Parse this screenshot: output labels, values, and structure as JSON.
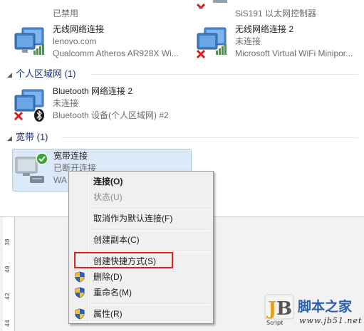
{
  "top_partial": {
    "left_sub": "已禁用",
    "right_sub": "SiS191 以太网控制器"
  },
  "wireless_connections": [
    {
      "name": "无线网络连接",
      "status": "lenovo.com",
      "device": "Qualcomm Atheros AR928X Wi..."
    },
    {
      "name": "无线网络连接 2",
      "status": "未连接",
      "device": "Microsoft Virtual WiFi Minipor..."
    }
  ],
  "groups": {
    "pan": "个人区域网 (1)",
    "broadband": "宽带 (1)"
  },
  "bluetooth_connection": {
    "name": "Bluetooth 网络连接 2",
    "status": "未连接",
    "device": "Bluetooth 设备(个人区域网) #2"
  },
  "broadband_connection": {
    "name": "宽带连接",
    "status": "已断开连接",
    "device": "WA"
  },
  "ruler_labels": [
    "38",
    "40",
    "42",
    "44"
  ],
  "context_menu": {
    "items": [
      {
        "label": "连接(O)",
        "bold": true,
        "disabled": false,
        "shield": false
      },
      {
        "label": "状态(U)",
        "bold": false,
        "disabled": true,
        "shield": false
      },
      {
        "label": "取消作为默认连接(F)",
        "bold": false,
        "disabled": false,
        "shield": false
      },
      {
        "label": "创建副本(C)",
        "bold": false,
        "disabled": false,
        "shield": false
      },
      {
        "label": "创建快捷方式(S)",
        "bold": false,
        "disabled": false,
        "shield": false
      },
      {
        "label": "删除(D)",
        "bold": false,
        "disabled": false,
        "shield": true
      },
      {
        "label": "重命名(M)",
        "bold": false,
        "disabled": false,
        "shield": true
      },
      {
        "label": "属性(R)",
        "bold": false,
        "disabled": false,
        "shield": true
      }
    ],
    "highlighted_item": "创建快捷方式(S)"
  },
  "watermark": {
    "logo_text": "JB",
    "sub_text": "Script",
    "site_name": "脚本之家",
    "url": "www.jb51.net"
  },
  "colors": {
    "group_header": "#1e3287",
    "selection_bg": "#dbe8f7",
    "highlight_box": "#e02020",
    "menu_bg": "#f0f0f0"
  }
}
